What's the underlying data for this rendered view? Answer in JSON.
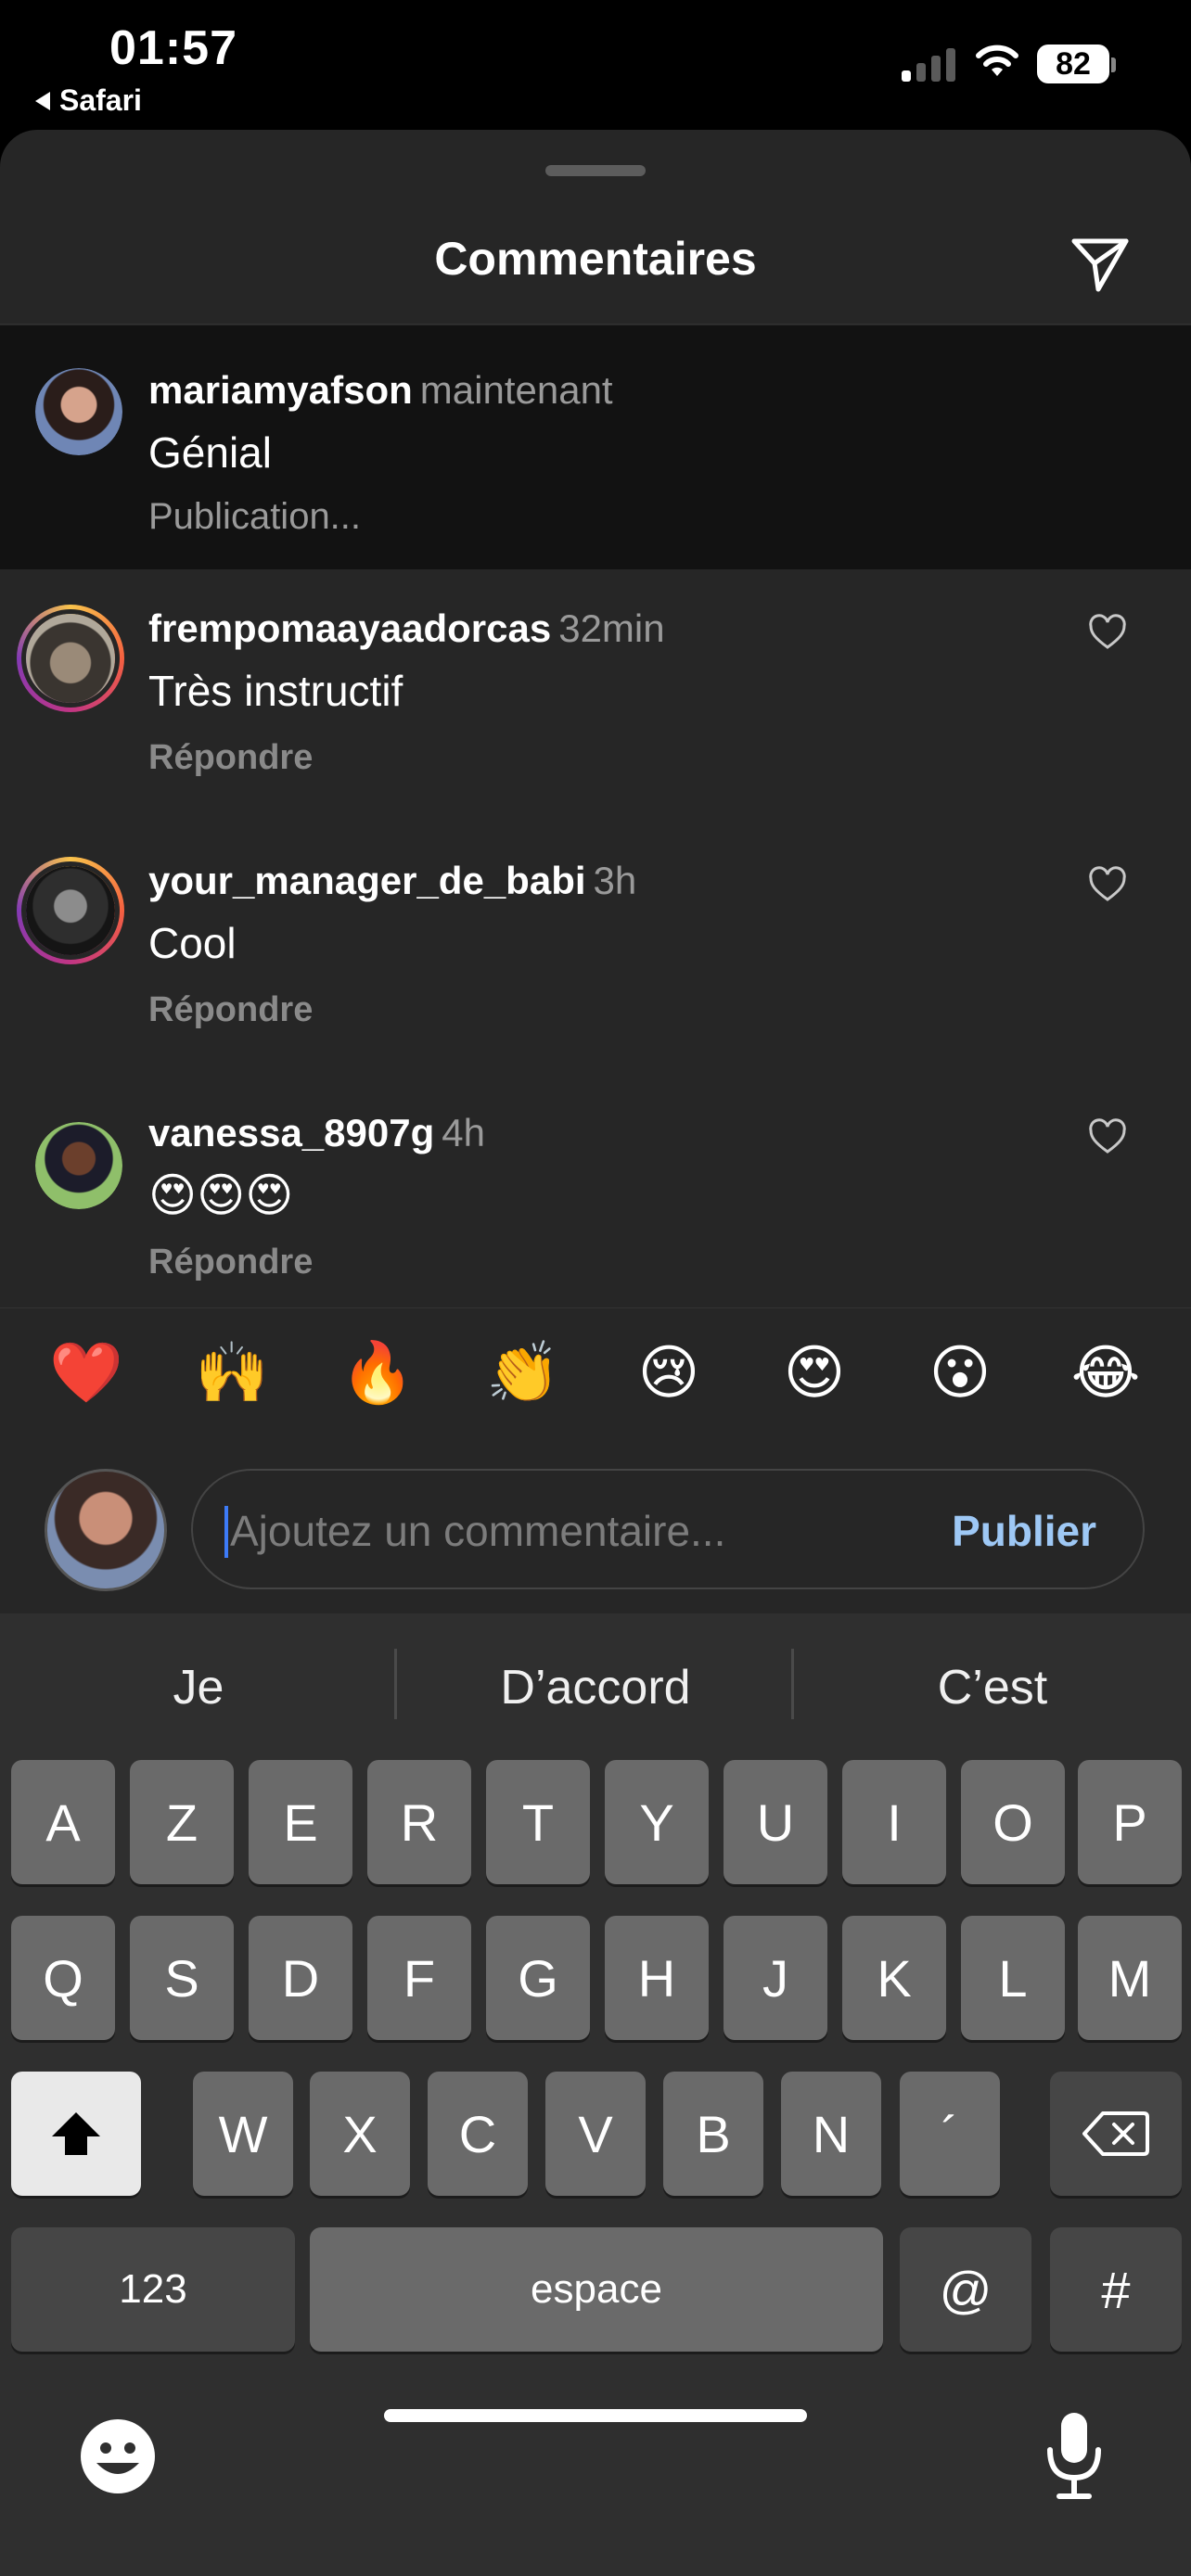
{
  "status_bar": {
    "time": "01:57",
    "back_app": "Safari",
    "battery": "82"
  },
  "sheet": {
    "title": "Commentaires"
  },
  "comments": [
    {
      "username": "mariamyafson",
      "time": "maintenant",
      "text": "Génial",
      "action": "Publication...",
      "highlighted": true
    },
    {
      "username": "frempomaayaadorcas",
      "time": "32min",
      "text": "Très instructif",
      "action": "Répondre"
    },
    {
      "username": "your_manager_de_babi",
      "time": "3h",
      "text": "Cool",
      "action": "Répondre"
    },
    {
      "username": "vanessa_8907g",
      "time": "4h",
      "text": "😍😍😍",
      "action": "Répondre"
    }
  ],
  "reactions": [
    "❤️",
    "🙌",
    "🔥",
    "👏",
    "😢",
    "😍",
    "😮",
    "😂"
  ],
  "composer": {
    "placeholder": "Ajoutez un commentaire...",
    "publish_label": "Publier"
  },
  "keyboard": {
    "suggestions": [
      "Je",
      "D’accord",
      "C’est"
    ],
    "row1": [
      "A",
      "Z",
      "E",
      "R",
      "T",
      "Y",
      "U",
      "I",
      "O",
      "P"
    ],
    "row2": [
      "Q",
      "S",
      "D",
      "F",
      "G",
      "H",
      "J",
      "K",
      "L",
      "M"
    ],
    "row3": [
      "W",
      "X",
      "C",
      "V",
      "B",
      "N",
      "´"
    ],
    "numbers_label": "123",
    "space_label": "espace",
    "at_label": "@",
    "hash_label": "#"
  },
  "colors": {
    "accent_publish": "#9ec8f5",
    "caret": "#3d7bf7",
    "sheet_bg": "#262626"
  }
}
